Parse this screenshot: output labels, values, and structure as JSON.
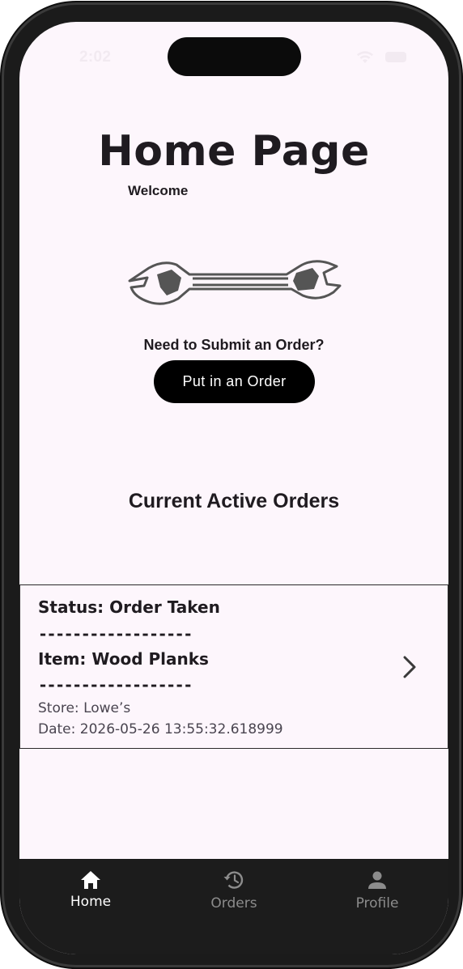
{
  "status_bar": {
    "time": "2:02"
  },
  "header": {
    "title": "Home Page",
    "welcome": "Welcome"
  },
  "order_section": {
    "prompt": "Need to Submit an Order?",
    "button_label": "Put in an Order"
  },
  "active_orders": {
    "title": "Current Active Orders",
    "orders": [
      {
        "status": "Status: Order Taken",
        "divider": "------------------",
        "item": "Item: Wood Planks",
        "store": "Store: Lowe’s",
        "date": "Date: 2026-05-26 13:55:32.618999"
      }
    ]
  },
  "bottom_nav": {
    "items": [
      {
        "label": "Home",
        "icon": "home-icon",
        "active": true
      },
      {
        "label": "Orders",
        "icon": "history-icon",
        "active": false
      },
      {
        "label": "Profile",
        "icon": "person-icon",
        "active": false
      }
    ]
  },
  "colors": {
    "background": "#fdf6fc",
    "text": "#1f1b20",
    "button": "#000000",
    "nav_bar": "#1c1c1c",
    "nav_active": "#ffffff",
    "nav_inactive": "#8c8c8c"
  }
}
